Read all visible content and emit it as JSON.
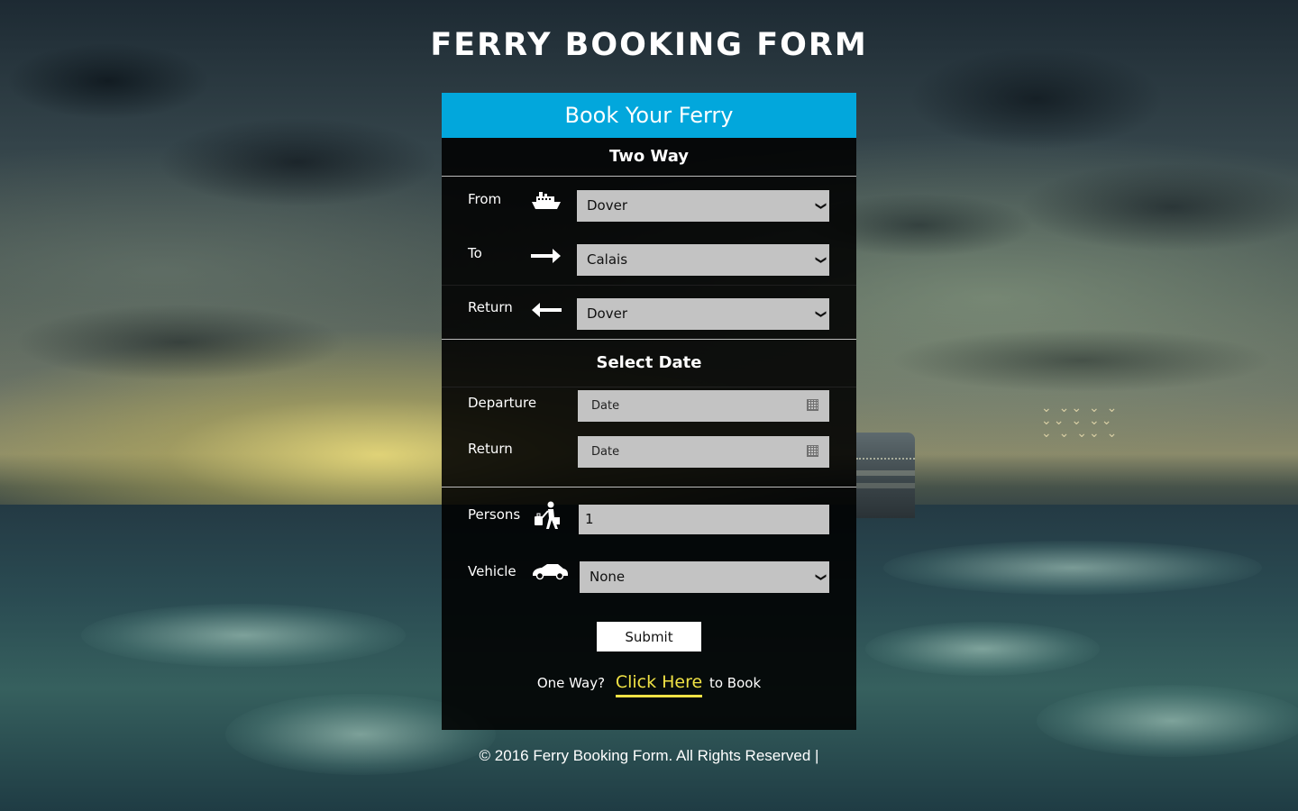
{
  "page": {
    "title": "FERRY BOOKING FORM"
  },
  "form": {
    "header": "Book Your Ferry",
    "trip_type_title": "Two Way",
    "from": {
      "label": "From",
      "value": "Dover",
      "icon": "ship-icon"
    },
    "to": {
      "label": "To",
      "value": "Calais",
      "icon": "arrow-right-icon"
    },
    "return_route": {
      "label": "Return",
      "value": "Dover",
      "icon": "arrow-left-icon"
    },
    "date_section_title": "Select Date",
    "departure": {
      "label": "Departure",
      "placeholder": "Date",
      "icon": "calendar-icon"
    },
    "return_date": {
      "label": "Return",
      "placeholder": "Date",
      "icon": "calendar-icon"
    },
    "persons": {
      "label": "Persons",
      "value": "1",
      "icon": "traveler-luggage-icon"
    },
    "vehicle": {
      "label": "Vehicle",
      "value": "None",
      "icon": "car-icon"
    },
    "submit_label": "Submit",
    "oneway": {
      "prefix": "One Way?",
      "link": "Click Here",
      "suffix": "to Book"
    }
  },
  "footer": {
    "text": "© 2016 Ferry Booking Form. All Rights Reserved |"
  },
  "colors": {
    "header_bar": "#02a7dc",
    "link": "#f0e245",
    "card_bg": "#000000",
    "field_bg": "#c3c3c3"
  }
}
